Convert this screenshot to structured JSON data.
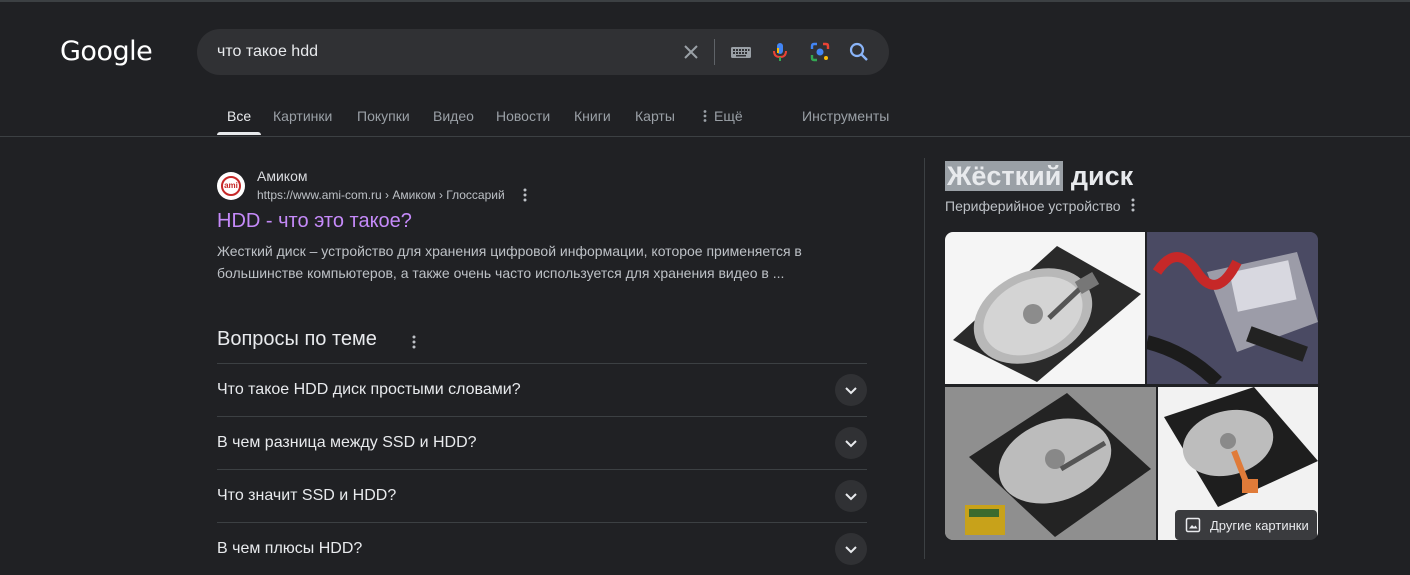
{
  "header": {
    "logo_text": "Google",
    "search_query": "что такое hdd"
  },
  "tabs": [
    {
      "label": "Все",
      "active": true
    },
    {
      "label": "Картинки"
    },
    {
      "label": "Покупки"
    },
    {
      "label": "Видео"
    },
    {
      "label": "Новости"
    },
    {
      "label": "Книги"
    },
    {
      "label": "Карты"
    },
    {
      "label": "Ещё"
    }
  ],
  "tools_label": "Инструменты",
  "result": {
    "favicon_text": "ami",
    "site_name": "Амиком",
    "site_url": "https://www.ami-com.ru › Амиком › Глоссарий",
    "title": "HDD - что это такое?",
    "snippet_line1": "Жесткий диск – устройство для хранения цифровой информации, которое применяется в",
    "snippet_line2": "большинстве компьютеров, а также очень часто используется для хранения видео в ..."
  },
  "related_questions": {
    "heading": "Вопросы по теме",
    "items": [
      "Что такое HDD диск простыми словами?",
      "В чем разница между SSD и HDD?",
      "Что значит SSD и HDD?",
      "В чем плюсы HDD?"
    ]
  },
  "knowledge_panel": {
    "title_highlight": "Жёсткий",
    "title_rest": " диск",
    "subtitle": "Периферийное устройство",
    "more_images_label": "Другие картинки"
  },
  "colors": {
    "background": "#202124",
    "search_box": "#303134",
    "visited_link": "#c58af9",
    "text_primary": "#e8eaed",
    "text_secondary": "#bdc1c6"
  },
  "icons": [
    "clear-icon",
    "keyboard-icon",
    "microphone-icon",
    "lens-icon",
    "search-icon",
    "more-vert-icon",
    "chevron-down-icon",
    "image-icon"
  ]
}
